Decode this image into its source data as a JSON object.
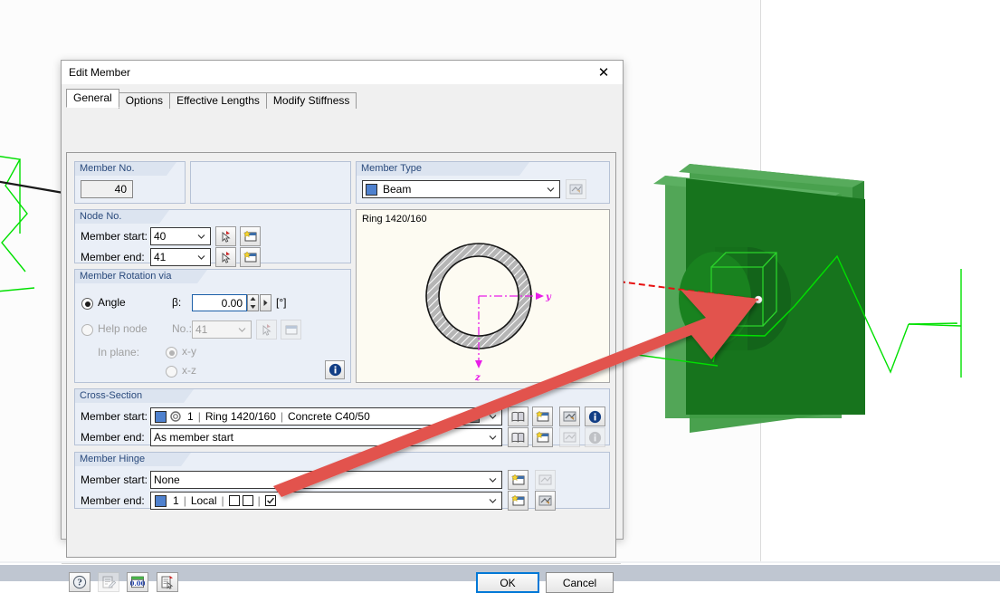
{
  "window": {
    "title": "Edit Member",
    "close_icon": "close-icon"
  },
  "tabs": [
    {
      "label": "General",
      "active": true
    },
    {
      "label": "Options",
      "active": false
    },
    {
      "label": "Effective Lengths",
      "active": false
    },
    {
      "label": "Modify Stiffness",
      "active": false
    }
  ],
  "member_no": {
    "group_label": "Member No.",
    "value": "40"
  },
  "member_type": {
    "group_label": "Member Type",
    "value": "Beam",
    "color": "#4f81ce",
    "button_icon": "edit-type-icon"
  },
  "node_no": {
    "group_label": "Node No.",
    "rows": [
      {
        "label": "Member start:",
        "value": "40",
        "pick_icon": "pick-node-icon",
        "new_icon": "new-node-icon"
      },
      {
        "label": "Member end:",
        "value": "41",
        "pick_icon": "pick-node-icon",
        "new_icon": "new-node-icon"
      }
    ]
  },
  "rotation": {
    "group_label": "Member Rotation via",
    "angle_option": "Angle",
    "angle_selected": true,
    "beta_label": "β:",
    "beta_value": "0.00",
    "beta_unit": "[°]",
    "help_node_option": "Help node",
    "help_node_selected": false,
    "no_label": "No.:",
    "no_value": "41",
    "in_plane_label": "In plane:",
    "plane_options": [
      {
        "label": "x-y",
        "selected": true
      },
      {
        "label": "x-z",
        "selected": false
      }
    ],
    "info_icon": "info-icon"
  },
  "cross_section": {
    "group_label": "Cross-Section",
    "preview_title": "Ring 1420/160",
    "rows": [
      {
        "label": "Member start:",
        "color": "#4f81ce",
        "number": "1",
        "section": "Ring 1420/160",
        "material": "Concrete C40/50",
        "hatch_swatch": "#8c8c8c",
        "icons": [
          "library-icon",
          "new-section-icon",
          "edit-section-icon",
          "info-icon"
        ],
        "info_enabled": true,
        "edit_enabled": true
      },
      {
        "label": "Member end:",
        "text": "As member start",
        "icons": [
          "library-icon",
          "new-section-icon",
          "edit-section-icon",
          "info-icon"
        ],
        "info_enabled": false,
        "edit_enabled": false
      }
    ]
  },
  "member_hinge": {
    "group_label": "Member Hinge",
    "rows": [
      {
        "label": "Member start:",
        "text": "None",
        "icons": [
          "new-hinge-icon",
          "edit-hinge-icon"
        ],
        "edit_enabled": false
      },
      {
        "label": "Member end:",
        "color": "#4f81ce",
        "number": "1",
        "axis": "Local",
        "checks": [
          false,
          false,
          true
        ],
        "icons": [
          "new-hinge-icon",
          "edit-hinge-icon"
        ],
        "edit_enabled": true
      }
    ]
  },
  "footer": {
    "tool_icons": [
      "help-icon",
      "comment-icon",
      "units-icon",
      "print-icon"
    ],
    "ok_label": "OK",
    "cancel_label": "Cancel"
  },
  "viewport": {
    "model_color_front": "#1a7a20",
    "model_color_side": "#3f9c45",
    "line_color": "#00e000",
    "node_color": "#ffffff",
    "annotation_color": "#e04a46",
    "pointer_line_color": "#e81010"
  }
}
